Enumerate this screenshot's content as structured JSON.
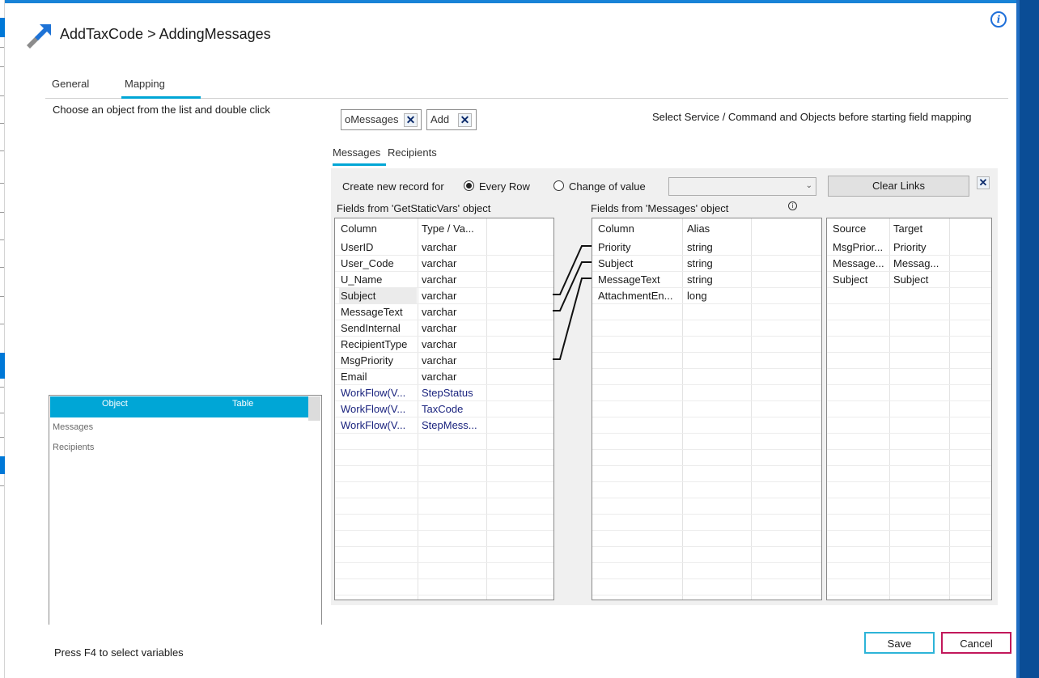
{
  "window": {
    "title": "AddTaxCode > AddingMessages"
  },
  "icons": {
    "app": "transfer-arrow-icon",
    "info": "info-icon"
  },
  "tabs": [
    {
      "label": "General",
      "active": false
    },
    {
      "label": "Mapping",
      "active": true
    }
  ],
  "left_panel": {
    "instruction": "Choose an object from the list and double click",
    "object_list": {
      "columns": [
        "Object",
        "Table"
      ],
      "items": [
        "Messages",
        "Recipients"
      ]
    },
    "footer_hint": "Press F4 to select variables"
  },
  "service": {
    "chips": [
      {
        "label": "oMessages"
      },
      {
        "label": "Add"
      }
    ],
    "hint": "Select Service / Command and Objects before starting field mapping"
  },
  "sub_tabs": [
    {
      "label": "Messages",
      "active": true
    },
    {
      "label": "Recipients",
      "active": false
    }
  ],
  "mapping": {
    "create_label": "Create new record for",
    "radio_every_row": "Every Row",
    "radio_change_value": "Change of value",
    "selected_mode": "Every Row",
    "change_value_selection": "",
    "clear_links_label": "Clear Links",
    "source_grid": {
      "title": "Fields from 'GetStaticVars' object",
      "columns": [
        "Column",
        "Type / Va..."
      ],
      "rows": [
        {
          "column": "UserID",
          "type": "varchar"
        },
        {
          "column": "User_Code",
          "type": "varchar"
        },
        {
          "column": "U_Name",
          "type": "varchar"
        },
        {
          "column": "Subject",
          "type": "varchar",
          "selected": true
        },
        {
          "column": "MessageText",
          "type": "varchar"
        },
        {
          "column": "SendInternal",
          "type": "varchar"
        },
        {
          "column": "RecipientType",
          "type": "varchar"
        },
        {
          "column": "MsgPriority",
          "type": "varchar"
        },
        {
          "column": "Email",
          "type": "varchar"
        },
        {
          "column": "WorkFlow(V...",
          "type": "StepStatus",
          "variable": true
        },
        {
          "column": "WorkFlow(V...",
          "type": "TaxCode",
          "variable": true
        },
        {
          "column": "WorkFlow(V...",
          "type": "StepMess...",
          "variable": true
        }
      ]
    },
    "target_grid": {
      "title": "Fields from 'Messages' object",
      "columns": [
        "Column",
        "Alias"
      ],
      "rows": [
        {
          "column": "Priority",
          "alias": "string"
        },
        {
          "column": "Subject",
          "alias": "string"
        },
        {
          "column": "MessageText",
          "alias": "string"
        },
        {
          "column": "AttachmentEn...",
          "alias": "long"
        }
      ]
    },
    "links_grid": {
      "columns": [
        "Source",
        "Target"
      ],
      "rows": [
        {
          "source": "MsgPrior...",
          "target": "Priority"
        },
        {
          "source": "Message...",
          "target": "Messag..."
        },
        {
          "source": "Subject",
          "target": "Subject"
        }
      ]
    }
  },
  "buttons": {
    "save": "Save",
    "cancel": "Cancel"
  },
  "colors": {
    "accent": "#00a6d6",
    "cancel_border": "#c2185b",
    "variable_text": "#1a237e"
  }
}
